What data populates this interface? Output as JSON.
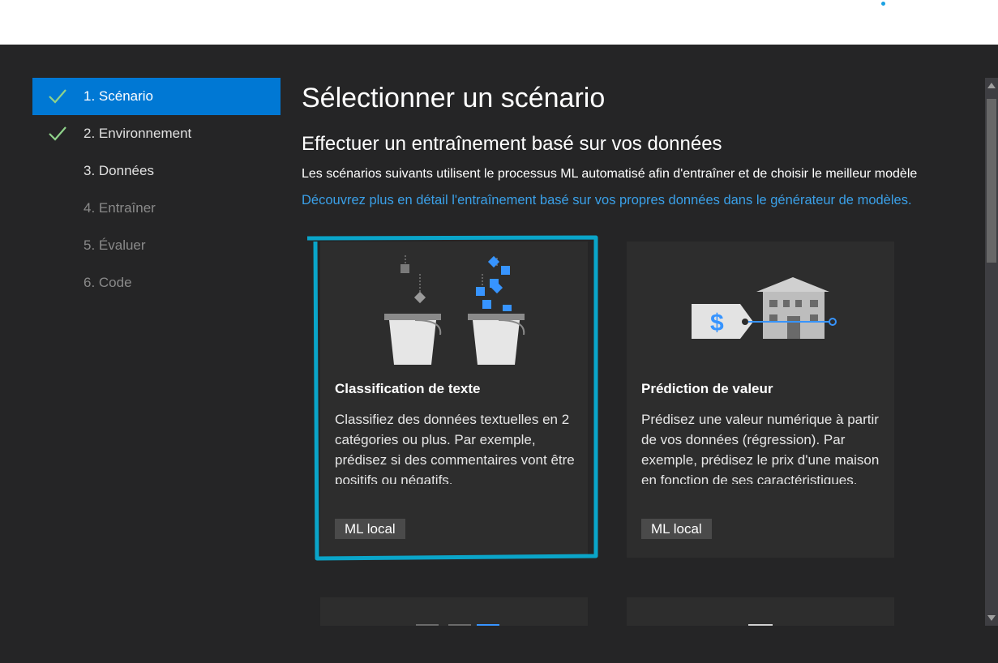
{
  "steps": [
    {
      "label": "1. Scénario",
      "state": "active",
      "done": true
    },
    {
      "label": "2. Environnement",
      "state": "done",
      "done": true
    },
    {
      "label": "3. Données",
      "state": "enabled",
      "done": false
    },
    {
      "label": "4. Entraîner",
      "state": "disabled",
      "done": false
    },
    {
      "label": "5. Évaluer",
      "state": "disabled",
      "done": false
    },
    {
      "label": "6. Code",
      "state": "disabled",
      "done": false
    }
  ],
  "main": {
    "title": "Sélectionner un scénario",
    "section_title": "Effectuer un entraînement basé sur vos données",
    "description": "Les scénarios suivants utilisent le processus ML automatisé afin d'entraîner et de choisir le meilleur modèle",
    "learn_more_link": "Découvrez plus en détail l'entraînement basé sur vos propres données dans le générateur de modèles."
  },
  "cards": [
    {
      "title": "Classification de texte",
      "description": "Classifiez des données textuelles en 2 catégories ou plus. Par exemple, prédisez si des commentaires vont être positifs ou négatifs.",
      "badge": "ML local",
      "icon": "buckets-icon",
      "selected": true
    },
    {
      "title": "Prédiction de valeur",
      "description": "Prédisez une valeur numérique à partir de vos données (régression). Par exemple, prédisez le prix d'une maison en fonction de ses caractéristiques.",
      "badge": "ML local",
      "icon": "house-price-tag-icon",
      "selected": false
    }
  ],
  "colors": {
    "accent": "#0078d4",
    "selection_border": "#0aa5c9",
    "check": "#8fd28a",
    "link": "#3aa0e8",
    "background": "#252526",
    "card": "#2d2d2d"
  }
}
